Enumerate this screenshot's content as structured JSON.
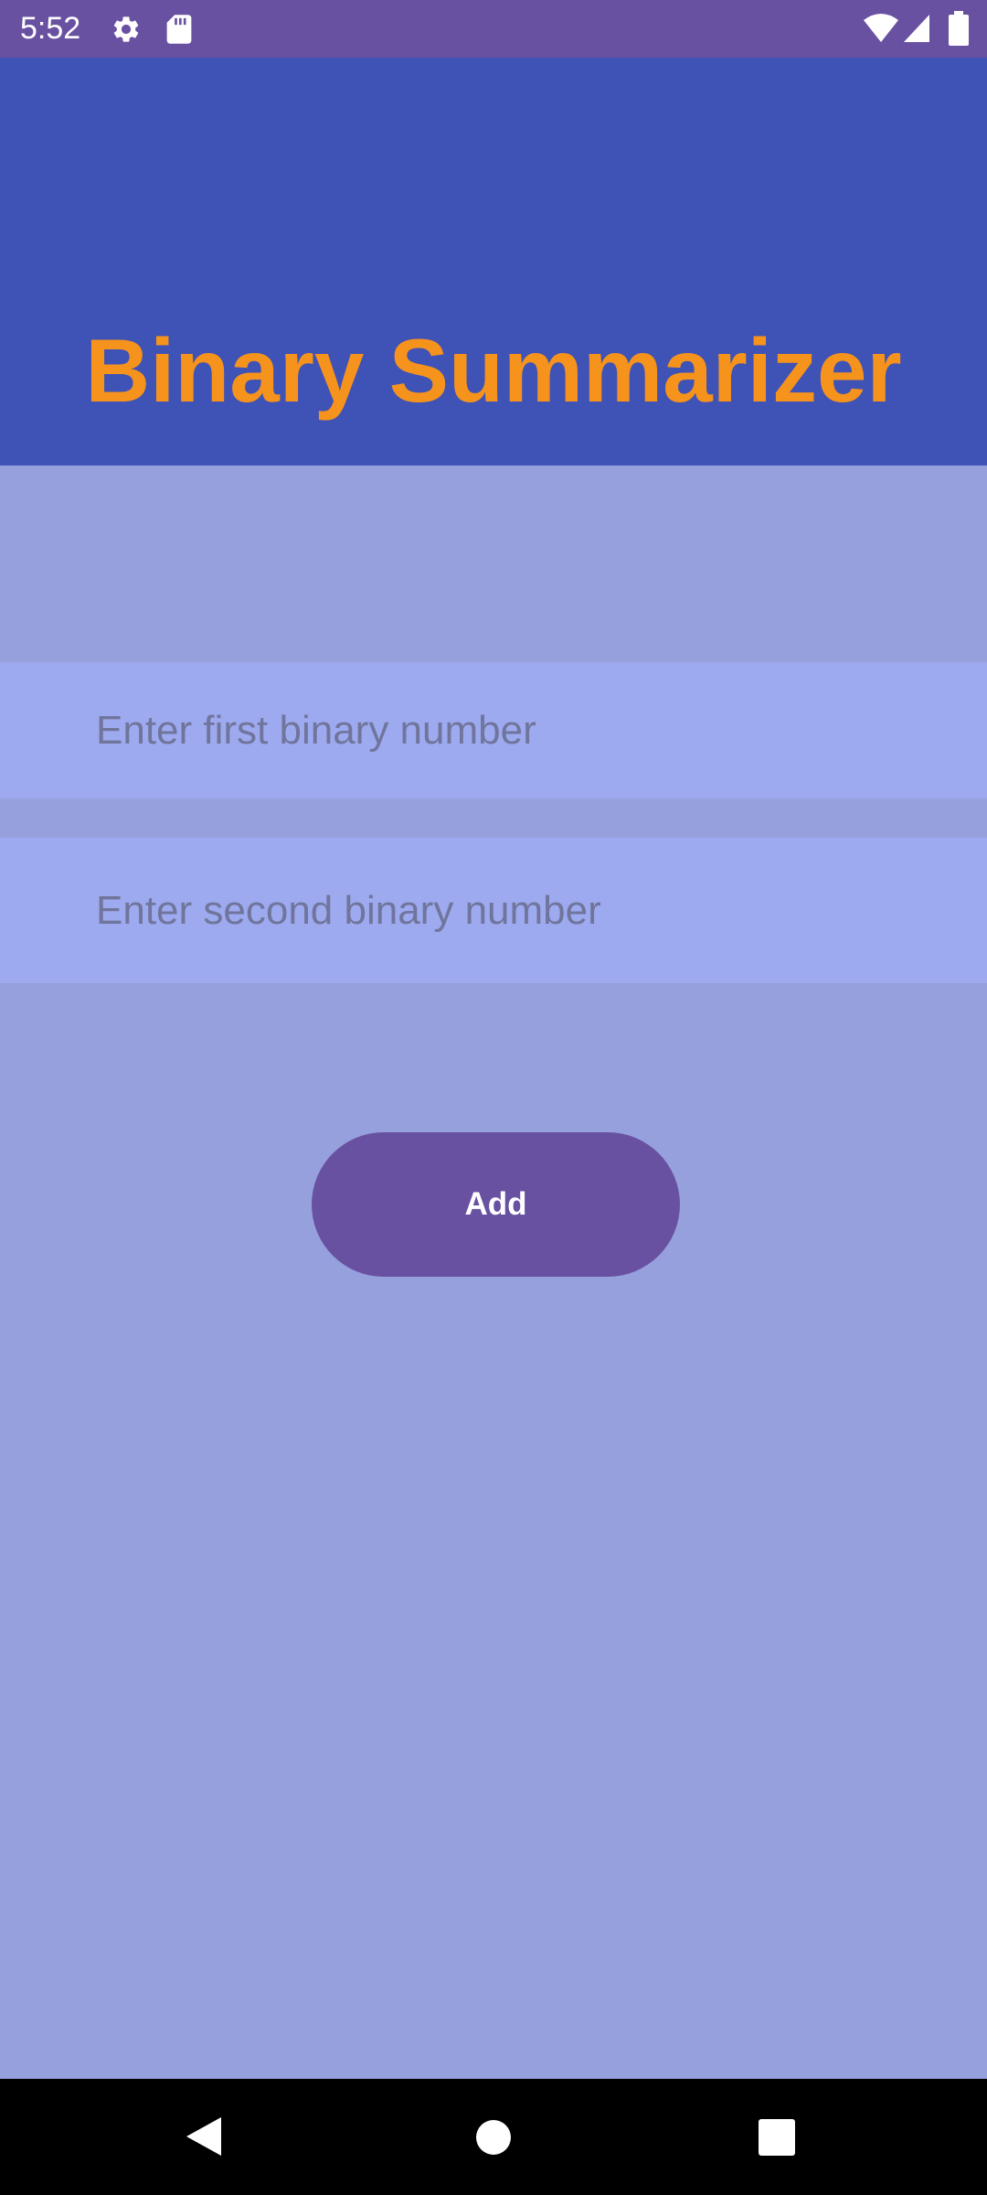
{
  "status_bar": {
    "time": "5:52",
    "icons": [
      "gear-icon",
      "sd-card-icon",
      "wifi-icon",
      "signal-icon",
      "battery-icon"
    ]
  },
  "header": {
    "title": "Binary Summarizer"
  },
  "form": {
    "first_input": {
      "placeholder": "Enter first binary number",
      "value": ""
    },
    "second_input": {
      "placeholder": "Enter second binary number",
      "value": ""
    },
    "add_label": "Add"
  },
  "nav_bar": {
    "icons": [
      "back-icon",
      "home-icon",
      "recents-icon"
    ]
  },
  "colors": {
    "status_bar": "#6951a2",
    "header": "#3f52b5",
    "title": "#f6931c",
    "background": "#96a0dc",
    "input_background": "#9eaaf0",
    "button": "#6951a2",
    "nav_bar": "#000000"
  }
}
